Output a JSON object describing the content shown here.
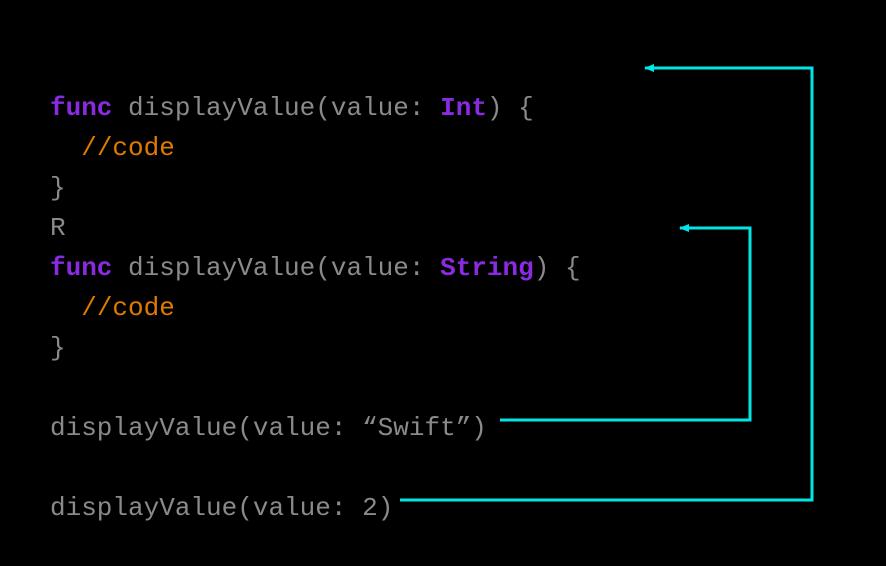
{
  "colors": {
    "background": "#000000",
    "keyword": "#8a2be2",
    "type": "#8a2be2",
    "comment": "#e07b00",
    "plain": "#8a8a8a",
    "arrow": "#00e5e5"
  },
  "code": {
    "line1": {
      "kw_func": "func",
      "name": " displayValue",
      "paren_open": "(",
      "label": "value",
      "colon_sp": ": ",
      "type": "Int",
      "paren_close_brace": ") {"
    },
    "line2": {
      "indent": "  ",
      "comment": "//code"
    },
    "line3": {
      "brace_close": "}"
    },
    "line4": {
      "text": "R"
    },
    "line5": {
      "kw_func": "func",
      "name": " displayValue",
      "paren_open": "(",
      "label": "value",
      "colon_sp": ": ",
      "type": "String",
      "paren_close_brace": ") {"
    },
    "line6": {
      "indent": "  ",
      "comment": "//code"
    },
    "line7": {
      "brace_close": "}"
    },
    "blank": "",
    "call1": {
      "name": "displayValue",
      "paren_open": "(",
      "label": "value",
      "colon_sp": ": ",
      "arg": "“Swift”",
      "paren_close": ")"
    },
    "call2": {
      "name": "displayValue",
      "paren_open": "(",
      "label": "value",
      "colon_sp": ": ",
      "arg": "2",
      "paren_close": ")"
    }
  },
  "diagram": {
    "description": "Arrows link each function call to the matching overload: the String call points to func displayValue(value: String), the Int call points to func displayValue(value: Int).",
    "links": [
      {
        "from_call": "displayValue(value: “Swift”)",
        "to_overload": "func displayValue(value: String)"
      },
      {
        "from_call": "displayValue(value: 2)",
        "to_overload": "func displayValue(value: Int)"
      }
    ]
  }
}
